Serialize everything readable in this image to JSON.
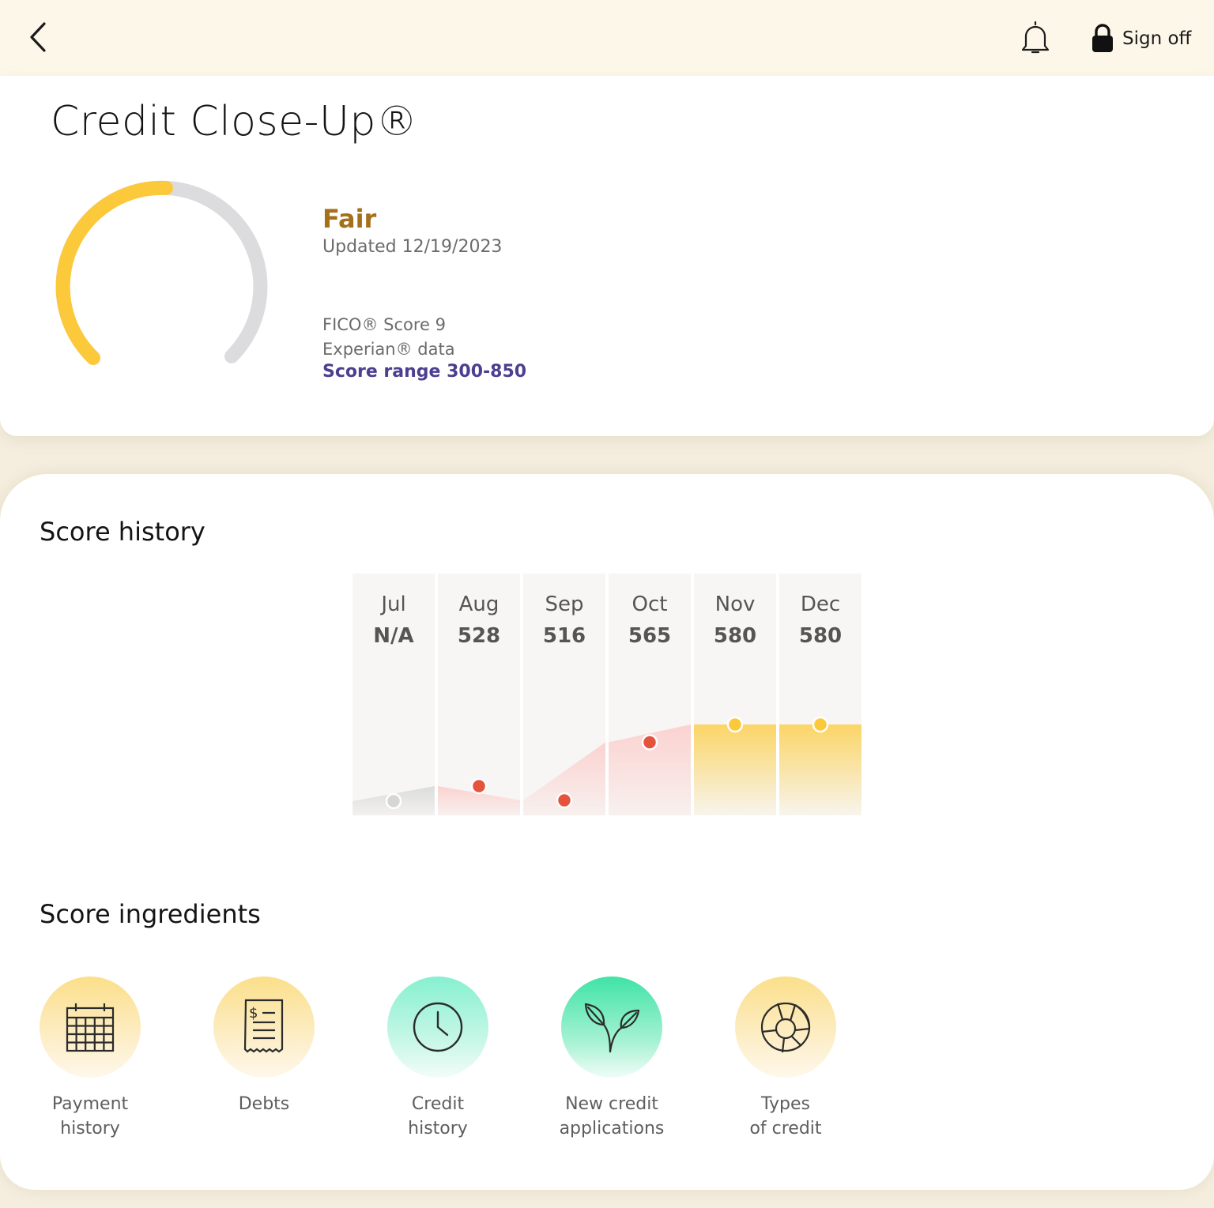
{
  "topbar": {
    "back_icon": "chevron-left-icon",
    "bell_icon": "bell-icon",
    "lock_icon": "lock-icon",
    "sign_off_label": "Sign off"
  },
  "score_card": {
    "title": "Credit Close-Up®",
    "rating": "Fair",
    "updated": "Updated 12/19/2023",
    "model_line1": "FICO® Score 9",
    "model_line2": "Experian® data",
    "range_link": "Score range 300-850",
    "gauge": {
      "score": 580,
      "min": 300,
      "max": 850,
      "color": "#fcc93b",
      "track_color": "#dcdcdf"
    }
  },
  "history": {
    "title": "Score history",
    "months": [
      {
        "month": "Jul",
        "score_label": "N/A",
        "score": null,
        "color": "#d6d6d6"
      },
      {
        "month": "Aug",
        "score_label": "528",
        "score": 528,
        "color": "#e5533d"
      },
      {
        "month": "Sep",
        "score_label": "516",
        "score": 516,
        "color": "#e5533d"
      },
      {
        "month": "Oct",
        "score_label": "565",
        "score": 565,
        "color": "#e5533d"
      },
      {
        "month": "Nov",
        "score_label": "580",
        "score": 580,
        "color": "#fcc93b"
      },
      {
        "month": "Dec",
        "score_label": "580",
        "score": 580,
        "color": "#fcc93b"
      }
    ]
  },
  "ingredients": {
    "title": "Score ingredients",
    "items": [
      {
        "label": "Payment\nhistory",
        "icon": "calendar-icon"
      },
      {
        "label": "Debts",
        "icon": "receipt-icon"
      },
      {
        "label": "Credit\nhistory",
        "icon": "clock-icon"
      },
      {
        "label": "New credit\napplications",
        "icon": "sprout-icon"
      },
      {
        "label": "Types\nof credit",
        "icon": "donut-chart-icon"
      }
    ]
  }
}
